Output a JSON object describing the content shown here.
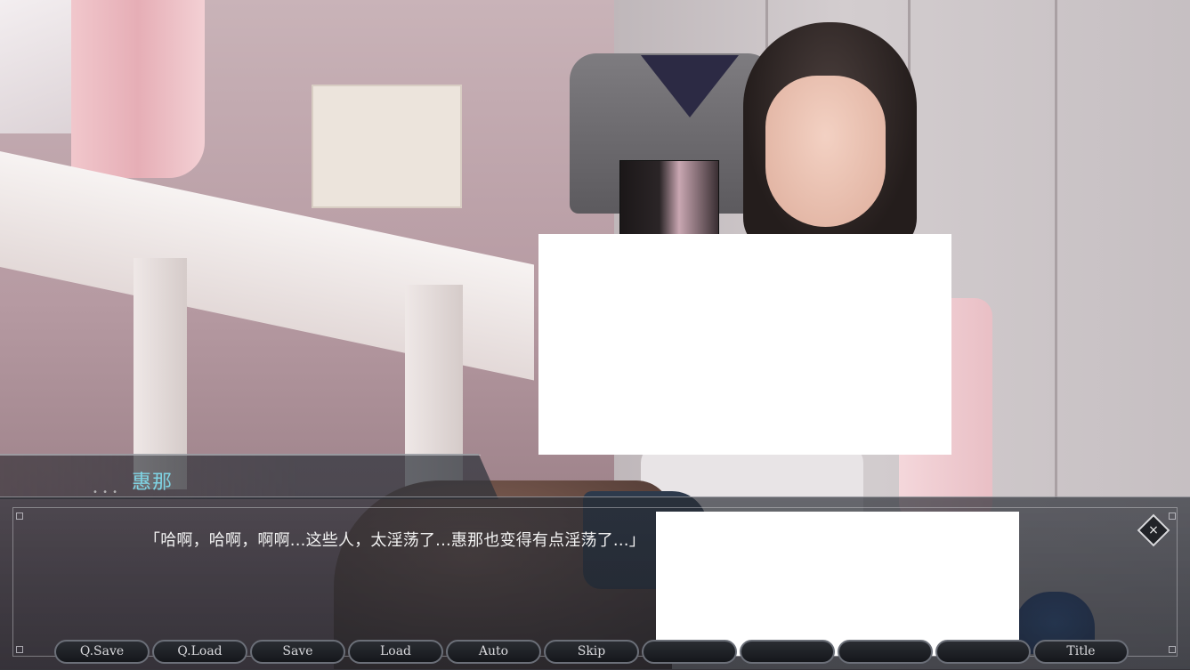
{
  "speaker": {
    "name": "惠那"
  },
  "dialogue": {
    "text": "「哈啊，哈啊，啊啊...这些人，太淫荡了...惠那也变得有点淫荡了...」"
  },
  "dialog_controls": {
    "close_label": "×"
  },
  "quick_menu": {
    "items": [
      {
        "label": "Q.Save"
      },
      {
        "label": "Q.Load"
      },
      {
        "label": "Save"
      },
      {
        "label": "Load"
      },
      {
        "label": "Auto"
      },
      {
        "label": "Skip"
      },
      {
        "label": ""
      },
      {
        "label": ""
      },
      {
        "label": ""
      },
      {
        "label": ""
      },
      {
        "label": "Title"
      }
    ]
  },
  "colors": {
    "speaker_name": "#7fd4e4",
    "dialogue_text": "#f2f2f2",
    "censor_block": "#ffffff"
  }
}
